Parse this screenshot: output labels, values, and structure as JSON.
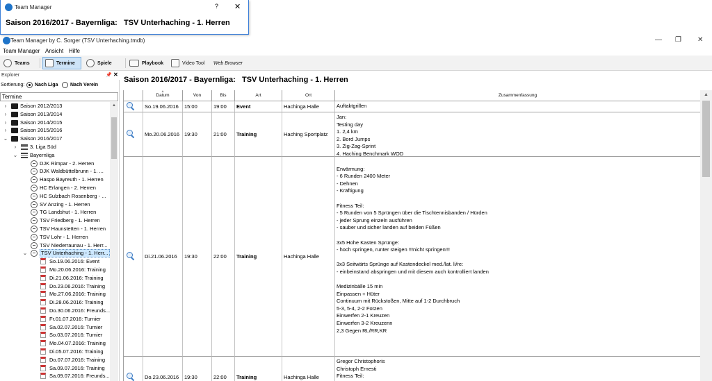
{
  "popup": {
    "title": "Team Manager",
    "help_label": "?",
    "close_label": "✕",
    "heading": "Saison 2016/2017 - Bayernliga:   TSV Unterhaching - 1. Herren"
  },
  "window": {
    "title": "Team Manager by C. Sorger (TSV Unterhaching.tmdb)",
    "minimize": "—",
    "maximize": "❐",
    "close": "✕"
  },
  "menu": [
    "Team Manager",
    "Ansicht",
    "Hilfe"
  ],
  "toolbar": {
    "teams": "Teams",
    "termine": "Termine",
    "spiele": "Spiele",
    "playbook": "Playbook",
    "video_tool": "Video Tool",
    "web_browser": "Web Browser"
  },
  "explorer": {
    "title": "Explorer",
    "pin": "📌",
    "close": "✕",
    "sort_label": "Sortierung:",
    "sort_option_1": "Nach Liga",
    "sort_option_2": "Nach Verein",
    "tree_header": "Termine"
  },
  "tree": [
    {
      "label": "Saison 2012/2013",
      "exp": "›"
    },
    {
      "label": "Saison 2013/2014",
      "exp": "›"
    },
    {
      "label": "Saison 2014/2015",
      "exp": "›"
    },
    {
      "label": "Saison 2015/2016",
      "exp": "›"
    },
    {
      "label": "Saison 2016/2017",
      "exp": "⌄"
    },
    {
      "label": "3. Liga Süd",
      "exp": "›"
    },
    {
      "label": "Bayernliga",
      "exp": "⌄"
    },
    {
      "label": "DJK Rimpar - 2. Herren"
    },
    {
      "label": "DJK Waldbüttelbrunn - 1. ..."
    },
    {
      "label": "Haspo Bayreuth - 1. Herren"
    },
    {
      "label": "HC Erlangen - 2. Herren"
    },
    {
      "label": "HC Sulzbach Rosenberg - ..."
    },
    {
      "label": "SV Anzing - 1. Herren"
    },
    {
      "label": "TG Landshut - 1. Herren"
    },
    {
      "label": "TSV Friedberg - 1. Herren"
    },
    {
      "label": "TSV Haunstetten - 1. Herren"
    },
    {
      "label": "TSV Lohr - 1. Herren"
    },
    {
      "label": "TSV Niederraunau - 1. Herr..."
    },
    {
      "label": "TSV Unterhaching - 1. Herr...",
      "exp": "⌄"
    },
    {
      "label": "So.19.06.2016: Event"
    },
    {
      "label": "Mo.20.06.2016: Training"
    },
    {
      "label": "Di.21.06.2016: Training"
    },
    {
      "label": "Do.23.06.2016: Training"
    },
    {
      "label": "Mo.27.06.2016: Training"
    },
    {
      "label": "Di.28.06.2016: Training"
    },
    {
      "label": "Do.30.06.2016: Freunds..."
    },
    {
      "label": "Fr.01.07.2016: Turnier"
    },
    {
      "label": "Sa.02.07.2016: Turnier"
    },
    {
      "label": "So.03.07.2016: Turnier"
    },
    {
      "label": "Mo.04.07.2016: Training"
    },
    {
      "label": "Di.05.07.2016: Training"
    },
    {
      "label": "Do.07.07.2016: Training"
    },
    {
      "label": "Sa.09.07.2016: Training"
    },
    {
      "label": "Sa.09.07.2016: Freunds..."
    }
  ],
  "content": {
    "title": "Saison 2016/2017 - Bayernliga:   TSV Unterhaching - 1. Herren"
  },
  "grid": {
    "columns": [
      "Datum",
      "Von",
      "Bis",
      "Art",
      "Ort",
      "Zusammenfassung"
    ],
    "rows": [
      {
        "datum": "So.19.06.2016",
        "von": "15:00",
        "bis": "19:00",
        "art": "Event",
        "ort": "Hachinga Halle",
        "summary": "Auftaktgrillen"
      },
      {
        "datum": "Mo.20.06.2016",
        "von": "19:30",
        "bis": "21:00",
        "art": "Training",
        "ort": "Haching Sportplatz",
        "summary": "Jan:\nTesting day\n1. 2,4 km\n2. Bord Jumps\n3. Zig-Zag-Sprint\n4. Haching Benchmark WOD"
      },
      {
        "datum": "Di.21.06.2016",
        "von": "19:30",
        "bis": "22:00",
        "art": "Training",
        "ort": "Hachinga Halle",
        "summary": "\nErwärmung:\n- 6 Runden 2400 Meter\n- Dehnen\n- Kräftigung\n\nFitness Teil:\n- 5 Runden von 5 Sprüngen über die Tischtennisbanden / Hürden\n- jeder Sprung einzeln ausführen\n- sauber und sicher landen auf beiden Füßen\n\n3x5 Hohe Kasten Sprünge:\n- hoch springen, runter steigen !!!nicht springen!!!\n\n3x3 Seitwärts Sprünge auf Kastendeckel med./lat. li/re:\n- einbeinstand abspringen und mit diesem auch kontrolliert landen\n\nMedizinbälle 15 min\nEinpassen + Hüter\nContinuum mit Rückstoßen, Mitte auf 1-2 Durchbruch\n5-3, 5-4, 2-2 Fotzen\nEinwerfen 2-1 Kreuzen\nEinwerfen 3-2 Kreuzenn\n2,3 Gegen RL/RR,KR"
      },
      {
        "datum": "Do.23.06.2016",
        "von": "19:30",
        "bis": "22:00",
        "art": "Training",
        "ort": "Hachinga Halle",
        "summary": "Gregor Christophoris\nChristoph Ernesti\nFitness Teil:"
      }
    ]
  }
}
